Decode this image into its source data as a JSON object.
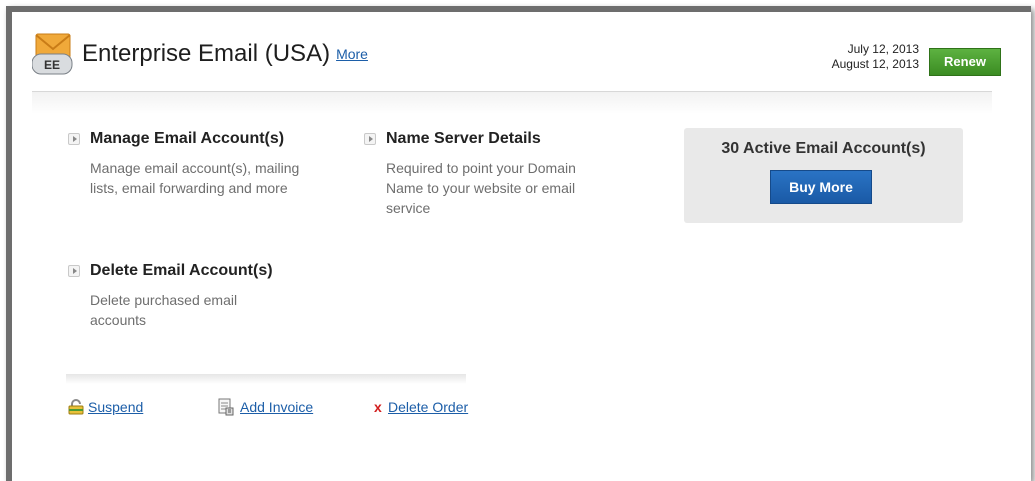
{
  "header": {
    "title": "Enterprise Email (USA)",
    "more_link": "More",
    "icon_badge": "EE",
    "icon": "envelope-icon",
    "date_start": "July 12, 2013",
    "date_end": "August 12, 2013",
    "renew_label": "Renew"
  },
  "actions": [
    {
      "title": "Manage Email Account(s)",
      "description": "Manage email account(s), mailing lists, email forwarding and more"
    },
    {
      "title": "Name Server Details",
      "description": "Required to point your Domain Name to your website or email service"
    },
    {
      "title": "Delete Email Account(s)",
      "description": "Delete purchased email accounts"
    }
  ],
  "accounts_panel": {
    "count_text": "30 Active Email Account(s)",
    "buy_more_label": "Buy More"
  },
  "footer": {
    "suspend_label": "Suspend",
    "suspend_icon": "lock-icon",
    "add_invoice_label": "Add Invoice",
    "add_invoice_icon": "invoice-icon",
    "delete_order_label": "Delete Order",
    "delete_order_icon": "x-icon",
    "delete_symbol": "x"
  },
  "colors": {
    "renew": "#3b8c22",
    "buy_more": "#1a5aa6",
    "link": "#1c5ea8",
    "delete": "#d21e1e"
  }
}
